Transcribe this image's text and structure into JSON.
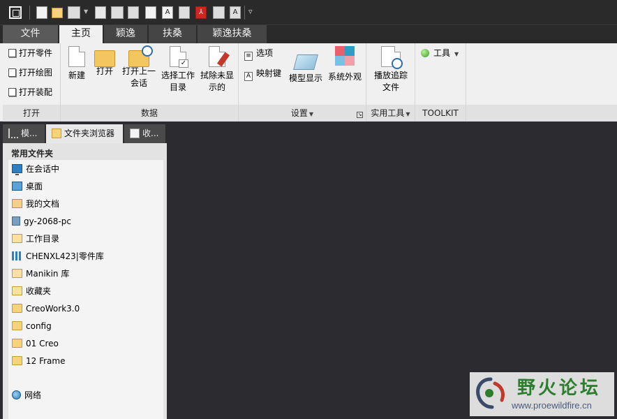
{
  "tabs": [
    "文件",
    "主页",
    "颖逸",
    "扶桑",
    "颖逸扶桑"
  ],
  "ribbon": {
    "open_group": {
      "items": [
        "打开零件",
        "打开绘图",
        "打开装配"
      ],
      "label": "打开"
    },
    "data_group": {
      "label": "数据",
      "buttons": [
        {
          "line1": "新建",
          "line2": ""
        },
        {
          "line1": "打开",
          "line2": ""
        },
        {
          "line1": "打开上一",
          "line2": "会话"
        },
        {
          "line1": "选择工作",
          "line2": "目录"
        },
        {
          "line1": "拭除未显",
          "line2": "示的"
        }
      ]
    },
    "settings_group": {
      "label": "设置",
      "options": "选项",
      "mapkeys": "映射键",
      "model_display": "模型显示",
      "appearance": "系统外观"
    },
    "utilities_group": {
      "label": "实用工具",
      "playback_line1": "播放追踪",
      "playback_line2": "文件"
    },
    "toolkit_group": {
      "label": "TOOLKIT",
      "tools": "工具"
    }
  },
  "nav_tabs": [
    "模...",
    "文件夹浏览器",
    "收..."
  ],
  "folder_panel": {
    "title": "常用文件夹",
    "items": [
      {
        "label": "在会话中",
        "icon": "monitor-icon"
      },
      {
        "label": "桌面",
        "icon": "desktop-icon"
      },
      {
        "label": "我的文档",
        "icon": "documents-icon"
      },
      {
        "label": "gy-2068-pc",
        "icon": "computer-icon"
      },
      {
        "label": "工作目录",
        "icon": "working-dir-icon"
      },
      {
        "label": "CHENXL423|零件库",
        "icon": "library-icon"
      },
      {
        "label": "Manikin 库",
        "icon": "manikin-library-icon"
      },
      {
        "label": "收藏夹",
        "icon": "favorites-icon"
      },
      {
        "label": "CreoWork3.0",
        "icon": "folder-icon"
      },
      {
        "label": "config",
        "icon": "folder-icon"
      },
      {
        "label": "01 Creo",
        "icon": "folder-icon"
      },
      {
        "label": "12 Frame",
        "icon": "folder-icon"
      }
    ],
    "network": "网络"
  },
  "watermark": {
    "title": "野火论坛",
    "url": "www.proewildfire.cn"
  }
}
